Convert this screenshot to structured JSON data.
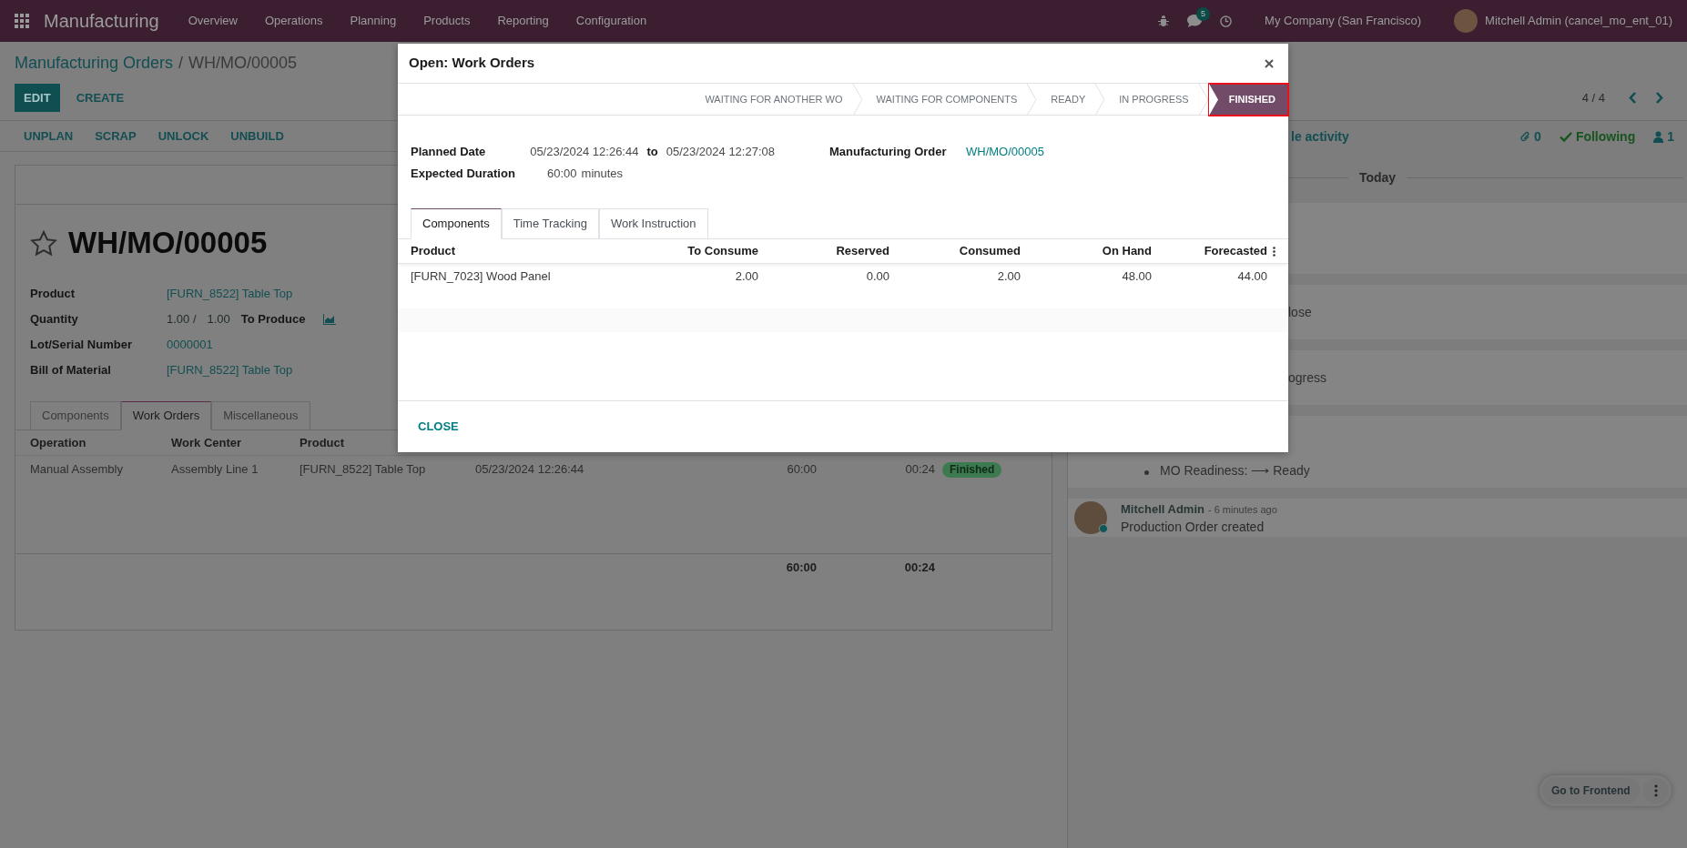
{
  "navbar": {
    "app_name": "Manufacturing",
    "menu": [
      "Overview",
      "Operations",
      "Planning",
      "Products",
      "Reporting",
      "Configuration"
    ],
    "message_count": "5",
    "company": "My Company (San Francisco)",
    "user": "Mitchell Admin (cancel_mo_ent_01)"
  },
  "breadcrumb": {
    "parent": "Manufacturing Orders",
    "separator": "/",
    "current": "WH/MO/00005"
  },
  "actions": [
    {
      "label": "EDIT",
      "primary": true
    },
    {
      "label": "CREATE",
      "primary": false
    }
  ],
  "pager": "4 / 4",
  "header_buttons": [
    "UNPLAN",
    "SCRAP",
    "UNLOCK",
    "UNBUILD"
  ],
  "form": {
    "title": "WH/MO/00005",
    "starred": false,
    "fields": [
      {
        "label": "Product",
        "kind": "link",
        "value": "[FURN_8522] Table Top"
      },
      {
        "label": "Quantity",
        "kind": "quantity",
        "value": "1.00 /",
        "max": "1.00",
        "unit_label": "To Produce"
      },
      {
        "label": "Lot/Serial Number",
        "kind": "link",
        "value": "0000001"
      },
      {
        "label": "Bill of Material",
        "kind": "link",
        "value": "[FURN_8522] Table Top"
      }
    ],
    "tabs": [
      {
        "label": "Components",
        "selected": false
      },
      {
        "label": "Work Orders",
        "selected": true
      },
      {
        "label": "Miscellaneous",
        "selected": false
      }
    ],
    "work_orders": {
      "columns": [
        "Operation",
        "Work Center",
        "Product"
      ],
      "rows": [
        {
          "operation": "Manual Assembly",
          "work_center": "Assembly Line 1",
          "product": "[FURN_8522] Table Top",
          "start": "05/23/2024 12:26:44",
          "expected": "60:00",
          "real": "00:24",
          "status": "Finished"
        }
      ],
      "totals": {
        "expected": "60:00",
        "real": "00:24"
      }
    }
  },
  "chatter": {
    "schedule_fragment": "le activity",
    "attachments": "0",
    "following": "Following",
    "followers": "1",
    "divider": "Today",
    "fragments": [
      "lose",
      "ogress"
    ],
    "readiness": "MO Readiness: ⟶ Ready",
    "message": {
      "author": "Mitchell Admin",
      "time": "- 6 minutes ago",
      "body": "Production Order created"
    }
  },
  "floating": {
    "label": "Go to Frontend"
  },
  "dialog": {
    "title": "Open: Work Orders",
    "stages": [
      {
        "label": "WAITING FOR ANOTHER WO",
        "selected": false,
        "highlighted": false
      },
      {
        "label": "WAITING FOR COMPONENTS",
        "selected": false,
        "highlighted": false
      },
      {
        "label": "READY",
        "selected": false,
        "highlighted": false
      },
      {
        "label": "IN PROGRESS",
        "selected": false,
        "highlighted": false
      },
      {
        "label": "FINISHED",
        "selected": true,
        "highlighted": true
      }
    ],
    "planned_date": {
      "label": "Planned Date",
      "start": "05/23/2024 12:26:44",
      "connector": "to",
      "end": "05/23/2024 12:27:08"
    },
    "duration": {
      "label": "Expected Duration",
      "value": "60:00",
      "unit": "minutes"
    },
    "order": {
      "label": "Manufacturing Order",
      "value": "WH/MO/00005"
    },
    "tabs": [
      {
        "label": "Components",
        "selected": true
      },
      {
        "label": "Time Tracking",
        "selected": false
      },
      {
        "label": "Work Instruction",
        "selected": false
      }
    ],
    "table": {
      "columns": [
        "Product",
        "To Consume",
        "Reserved",
        "Consumed",
        "On Hand",
        "Forecasted"
      ],
      "rows": [
        [
          "[FURN_7023] Wood Panel",
          "2.00",
          "0.00",
          "2.00",
          "48.00",
          "44.00"
        ]
      ]
    },
    "close_label": "CLOSE"
  }
}
